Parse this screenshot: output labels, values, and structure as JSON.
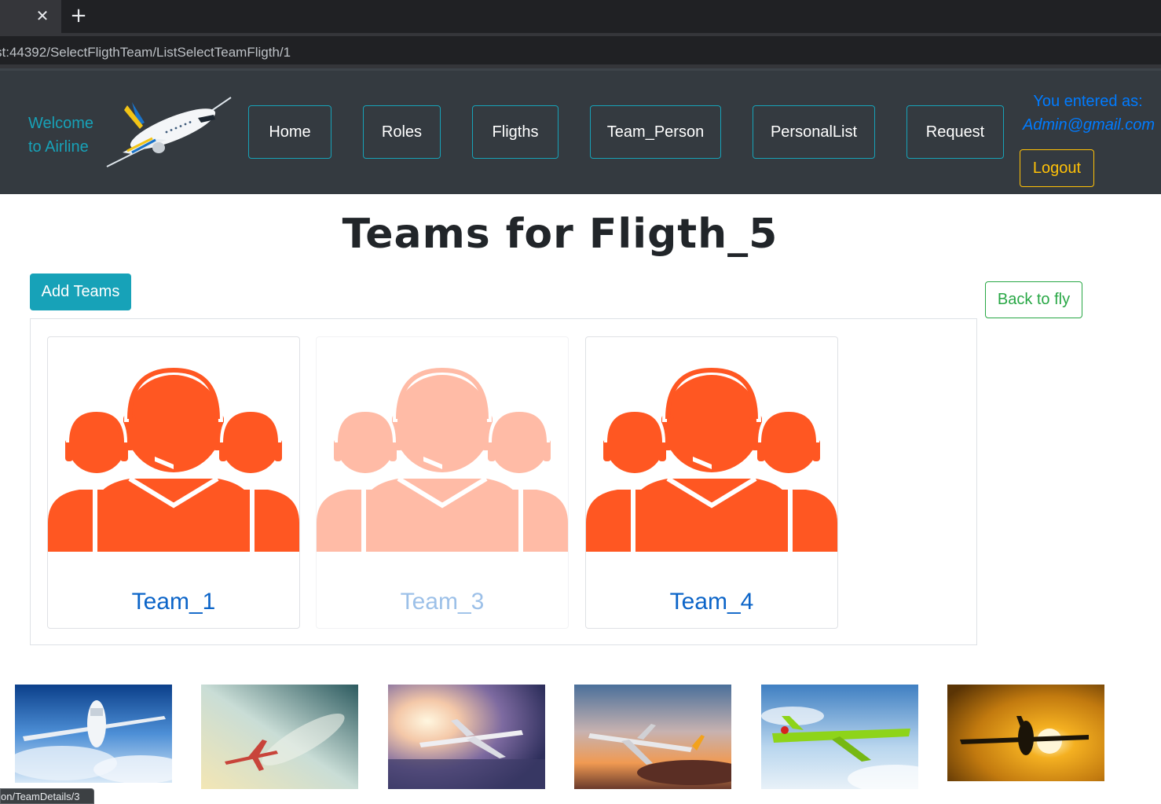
{
  "browser": {
    "tab_close": "✕",
    "new_tab": "+",
    "url": "st:44392/SelectFligthTeam/ListSelectTeamFligth/1",
    "status_link": "on/TeamDetails/3"
  },
  "header": {
    "welcome_line1": "Welcome",
    "welcome_line2": "to Airline",
    "nav": [
      "Home",
      "Roles",
      "Fligths",
      "Team_Person",
      "PersonalList",
      "Request"
    ],
    "user_label": "You entered as:",
    "user_email": "Admin@gmail.com",
    "logout": "Logout"
  },
  "main": {
    "title": "Teams for Fligth_5",
    "add_button": "Add Teams",
    "back_button": "Back to fly",
    "teams": [
      {
        "name": "Team_1"
      },
      {
        "name": "Team_3"
      },
      {
        "name": "Team_4"
      }
    ]
  },
  "colors": {
    "navbar": "#343a40",
    "accent": "#17a2b8",
    "team_icon": "#ff5722",
    "team_link": "#0b64c8",
    "logout": "#ffc107",
    "back": "#28a745"
  }
}
